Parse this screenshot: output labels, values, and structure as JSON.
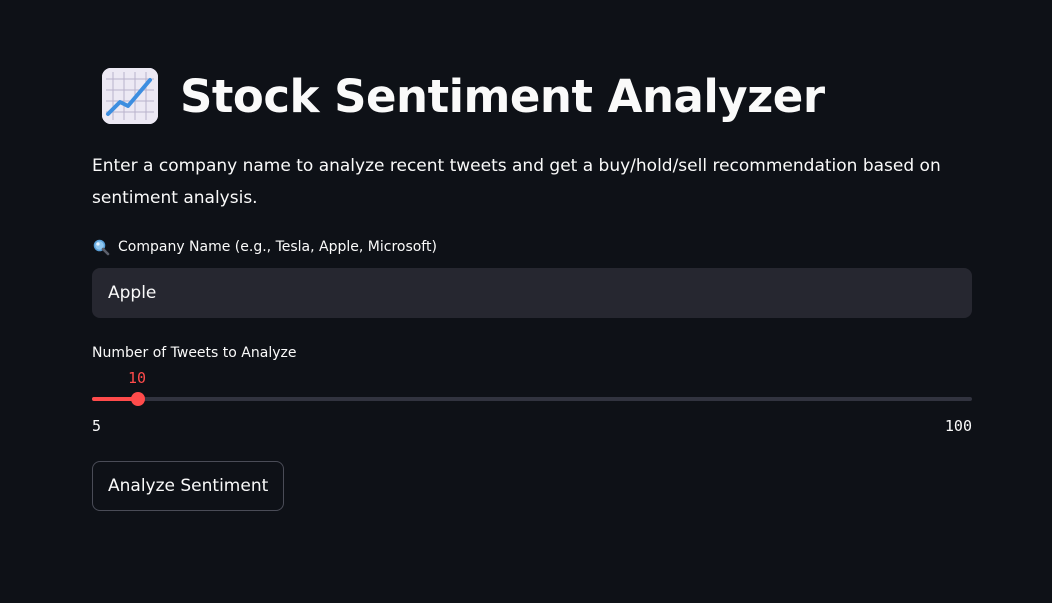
{
  "header": {
    "icon": "chart-increasing-icon",
    "title": "Stock Sentiment Analyzer"
  },
  "description": "Enter a company name to analyze recent tweets and get a buy/hold/sell recommendation based on sentiment analysis.",
  "company_input": {
    "icon": "magnifying-glass-icon",
    "label": "Company Name (e.g., Tesla, Apple, Microsoft)",
    "value": "Apple"
  },
  "tweet_slider": {
    "label": "Number of Tweets to Analyze",
    "value": "10",
    "min": "5",
    "max": "100"
  },
  "analyze_button": {
    "label": "Analyze Sentiment"
  },
  "colors": {
    "background": "#0e1117",
    "input_background": "#262730",
    "accent": "#ff4b4b",
    "text": "#fafafa"
  }
}
